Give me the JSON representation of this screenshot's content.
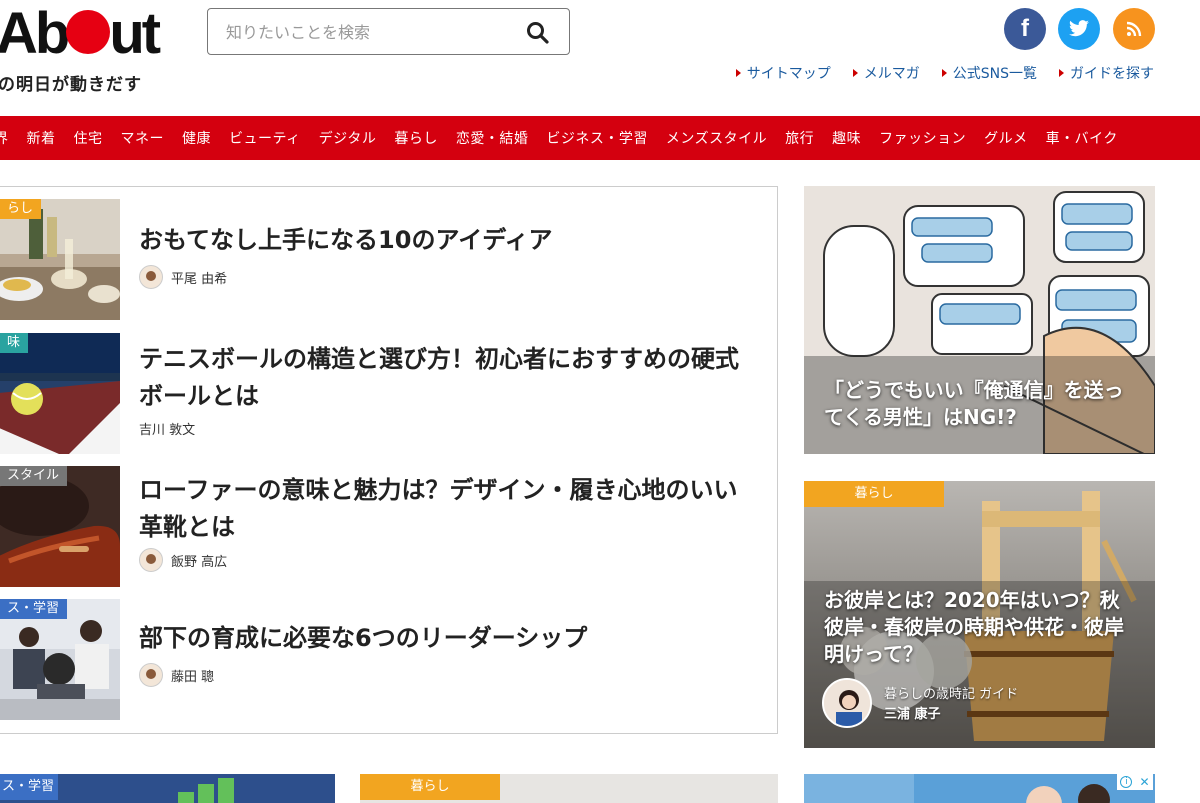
{
  "header": {
    "logo_text_1": "Ab",
    "logo_text_2": "ut",
    "tagline": "の明日が動きだす",
    "search_placeholder": "知りたいことを検索",
    "social": {
      "facebook": "f",
      "twitter": "twitter",
      "rss": "rss"
    },
    "links": [
      "サイトマップ",
      "メルマガ",
      "公式SNS一覧",
      "ガイドを探す"
    ]
  },
  "nav": [
    "界",
    "新着",
    "住宅",
    "マネー",
    "健康",
    "ビューティ",
    "デジタル",
    "暮らし",
    "恋愛・結婚",
    "ビジネス・学習",
    "メンズスタイル",
    "旅行",
    "趣味",
    "ファッション",
    "グルメ",
    "車・バイク"
  ],
  "articles": [
    {
      "category": "らし",
      "cat_color": "#f2a520",
      "title": "おもてなし上手になる10のアイディア",
      "author": "平尾 由希"
    },
    {
      "category": "味",
      "cat_color": "#2aa3a0",
      "title": "テニスボールの構造と選び方！初心者におすすめの硬式ボールとは",
      "author": "吉川 敦文"
    },
    {
      "category": "スタイル",
      "cat_color": "#777777",
      "title": "ローファーの意味と魅力は？デザイン・履き心地のいい革靴とは",
      "author": "飯野 高広"
    },
    {
      "category": "ス・学習",
      "cat_color": "#3b6fc4",
      "title": "部下の育成に必要な6つのリーダーシップ",
      "author": "藤田 聰"
    }
  ],
  "side_cards": [
    {
      "title": "「どうでもいい『俺通信』を送ってくる男性」はNG!?"
    },
    {
      "category": "暮らし",
      "title": "お彼岸とは？2020年はいつ？秋彼岸・春彼岸の時期や供花・彼岸明けって？",
      "guide_label": "暮らしの歳時記 ガイド",
      "guide_name": "三浦 康子"
    }
  ],
  "bottom": [
    {
      "category": "ス・学習"
    },
    {
      "category": "暮らし"
    }
  ]
}
